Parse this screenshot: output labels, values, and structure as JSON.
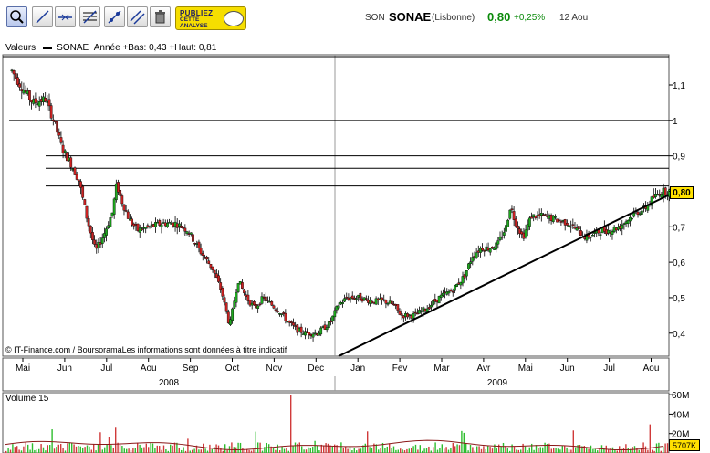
{
  "toolbar": {
    "tools": [
      "zoom-tool",
      "line-tool",
      "horizontal-line-tool",
      "fibonacci-tool",
      "resistance-tool",
      "channel-tool",
      "delete-tool"
    ],
    "promo": {
      "line1": "PUBLIEZ",
      "line2": "CETTE",
      "line3": "ANALYSE"
    }
  },
  "ticker": {
    "code": "SON",
    "name": "SONAE",
    "market": "(Lisbonne)",
    "price": "0,80",
    "change": "+0,25%",
    "date": "12 Aou"
  },
  "legend": {
    "prefix": "Valeurs",
    "series": "SONAE",
    "stats": "Année +Bas: 0,43 +Haut: 0,81"
  },
  "copyright": "© IT-Finance.com / BoursoramaLes informations sont données à titre indicatif",
  "price_tag": "0,80",
  "volume": {
    "label": "Volume 15",
    "current": "5707K"
  },
  "colors": {
    "up": "#1faa1f",
    "down": "#cc2222",
    "volume_up": "#2ebd2e",
    "volume_down": "#d03a3a",
    "avg": "#8b1a1a",
    "tag": "#ffe100"
  },
  "chart_data": {
    "type": "candlestick",
    "title": "SONAE",
    "y_ticks": [
      "1,1",
      "1",
      "0,9",
      "0,8",
      "0,7",
      "0,6",
      "0,5",
      "0,4"
    ],
    "y_tick_values": [
      1.1,
      1.0,
      0.9,
      0.8,
      0.7,
      0.6,
      0.5,
      0.4
    ],
    "ylim": [
      0.335,
      1.185
    ],
    "month_labels": [
      "Mai",
      "Jun",
      "Jul",
      "Aou",
      "Sep",
      "Oct",
      "Nov",
      "Dec",
      "Jan",
      "Fev",
      "Mar",
      "Avr",
      "Mai",
      "Jun",
      "Jul",
      "Aou"
    ],
    "year_labels": [
      "2008",
      "2009"
    ],
    "horizontal_levels": [
      1.18,
      1.0,
      0.9,
      0.865,
      0.815
    ],
    "trendline": {
      "start": {
        "month_index": 7.8,
        "value": 0.335
      },
      "end": {
        "month_index": 16.3,
        "value": 0.79
      }
    },
    "price_points": [
      [
        0,
        1.14
      ],
      [
        0.2,
        1.1
      ],
      [
        0.5,
        1.05
      ],
      [
        0.8,
        1.06
      ],
      [
        1.0,
        1.0
      ],
      [
        1.2,
        0.92
      ],
      [
        1.4,
        0.88
      ],
      [
        1.6,
        0.83
      ],
      [
        1.8,
        0.72
      ],
      [
        2.0,
        0.63
      ],
      [
        2.2,
        0.68
      ],
      [
        2.4,
        0.74
      ],
      [
        2.5,
        0.82
      ],
      [
        2.6,
        0.78
      ],
      [
        2.8,
        0.72
      ],
      [
        3.0,
        0.69
      ],
      [
        3.3,
        0.7
      ],
      [
        3.6,
        0.71
      ],
      [
        3.9,
        0.71
      ],
      [
        4.2,
        0.69
      ],
      [
        4.5,
        0.63
      ],
      [
        4.8,
        0.58
      ],
      [
        5.0,
        0.52
      ],
      [
        5.2,
        0.42
      ],
      [
        5.4,
        0.55
      ],
      [
        5.6,
        0.5
      ],
      [
        5.8,
        0.47
      ],
      [
        6.0,
        0.5
      ],
      [
        6.2,
        0.48
      ],
      [
        6.4,
        0.46
      ],
      [
        6.6,
        0.43
      ],
      [
        6.8,
        0.41
      ],
      [
        7.0,
        0.4
      ],
      [
        7.3,
        0.4
      ],
      [
        7.6,
        0.43
      ],
      [
        7.8,
        0.48
      ],
      [
        8.0,
        0.5
      ],
      [
        8.3,
        0.5
      ],
      [
        8.6,
        0.49
      ],
      [
        8.9,
        0.49
      ],
      [
        9.1,
        0.48
      ],
      [
        9.3,
        0.45
      ],
      [
        9.6,
        0.45
      ],
      [
        9.9,
        0.47
      ],
      [
        10.2,
        0.5
      ],
      [
        10.5,
        0.52
      ],
      [
        10.8,
        0.56
      ],
      [
        11.0,
        0.62
      ],
      [
        11.2,
        0.64
      ],
      [
        11.4,
        0.64
      ],
      [
        11.6,
        0.65
      ],
      [
        11.8,
        0.7
      ],
      [
        11.9,
        0.76
      ],
      [
        12.0,
        0.72
      ],
      [
        12.2,
        0.67
      ],
      [
        12.4,
        0.73
      ],
      [
        12.7,
        0.73
      ],
      [
        13.0,
        0.72
      ],
      [
        13.3,
        0.71
      ],
      [
        13.5,
        0.69
      ],
      [
        13.7,
        0.67
      ],
      [
        13.9,
        0.68
      ],
      [
        14.1,
        0.69
      ],
      [
        14.3,
        0.69
      ],
      [
        14.5,
        0.7
      ],
      [
        14.7,
        0.72
      ],
      [
        14.9,
        0.74
      ],
      [
        15.1,
        0.75
      ],
      [
        15.3,
        0.78
      ],
      [
        15.5,
        0.8
      ],
      [
        15.7,
        0.8
      ]
    ],
    "volume_axis": {
      "ticks": [
        "60M",
        "40M",
        "20M"
      ],
      "values": [
        60,
        40,
        20
      ],
      "ylim": [
        0,
        62
      ]
    }
  }
}
